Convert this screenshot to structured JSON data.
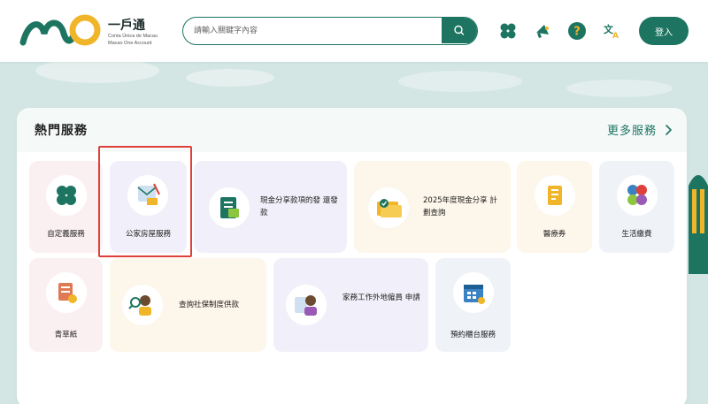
{
  "header": {
    "logo_title": "一戶通",
    "logo_sub1": "Conta Única de Macau",
    "logo_sub2": "Macao One Account",
    "search_placeholder": "請輸入關鍵字內容",
    "icons": [
      "grid-icon",
      "megaphone-icon",
      "help-icon",
      "translate-icon"
    ],
    "login_label": "登入"
  },
  "hot_services": {
    "title": "熱門服務",
    "more_label": "更多服務",
    "row1": [
      {
        "label": "自定義服務",
        "icon": "clover-icon"
      },
      {
        "label": "公家房屋服務",
        "icon": "housing-document-icon"
      },
      {
        "label": "現金分享款項的發 還發款",
        "icon": "cash-document-icon"
      },
      {
        "label": "2025年度現金分享 計劃查詢",
        "icon": "cash-check-icon"
      },
      {
        "label": "醫療券",
        "icon": "medical-voucher-icon"
      },
      {
        "label": "生活繳費",
        "icon": "bill-payment-icon"
      }
    ],
    "row2": [
      {
        "label": "青草紙",
        "icon": "certificate-icon"
      },
      {
        "label": "查詢社保制度供款",
        "icon": "social-security-icon"
      },
      {
        "label": "家務工作外地僱員 申請",
        "icon": "domestic-worker-icon"
      },
      {
        "label": "預約櫃台服務",
        "icon": "calendar-icon"
      }
    ]
  },
  "colors": {
    "brand_green": "#1d7561",
    "logo_yellow": "#f1b52a",
    "highlight_red": "#e0403a",
    "tile_pink": "#fbf0f1",
    "tile_lavender": "#f1f0fa",
    "tile_cream": "#fdf6ea",
    "tile_blue": "#eff3f8"
  }
}
